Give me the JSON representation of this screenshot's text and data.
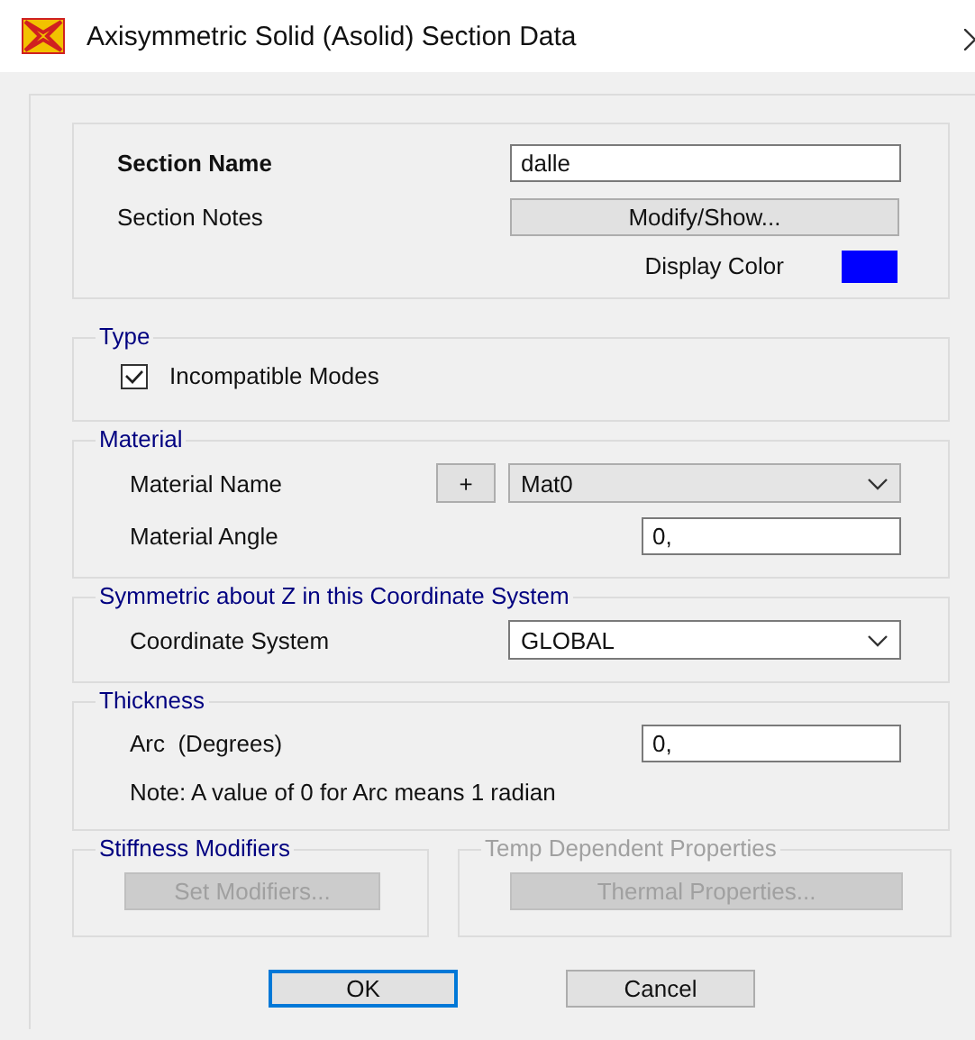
{
  "window": {
    "title": "Axisymmetric Solid (Asolid) Section Data"
  },
  "section": {
    "name_label": "Section Name",
    "name_value": "dalle",
    "notes_label": "Section Notes",
    "notes_button": "Modify/Show...",
    "color_label": "Display Color",
    "color": "#0000ff"
  },
  "type": {
    "title": "Type",
    "options": [
      {
        "label": "Incompatible Modes",
        "checked": true
      }
    ]
  },
  "material": {
    "title": "Material",
    "name_label": "Material Name",
    "add_button": "+",
    "name_value": "Mat0",
    "angle_label": "Material Angle",
    "angle_value": "0,"
  },
  "coordinates": {
    "title": "Symmetric about Z in this Coordinate System",
    "label": "Coordinate System",
    "value": "GLOBAL"
  },
  "thickness": {
    "title": "Thickness",
    "arc_label": "Arc  (Degrees)",
    "arc_value": "0,",
    "note": "Note: A value of 0 for Arc means 1 radian"
  },
  "stiffness": {
    "title": "Stiffness Modifiers",
    "disabled": false,
    "button": "Set Modifiers...",
    "button_disabled": true
  },
  "temperature": {
    "title": "Temp Dependent Properties",
    "disabled": true,
    "button": "Thermal Properties...",
    "button_disabled": true
  },
  "buttons": [
    {
      "label": "OK",
      "default": true
    },
    {
      "label": "Cancel",
      "default": false
    }
  ]
}
